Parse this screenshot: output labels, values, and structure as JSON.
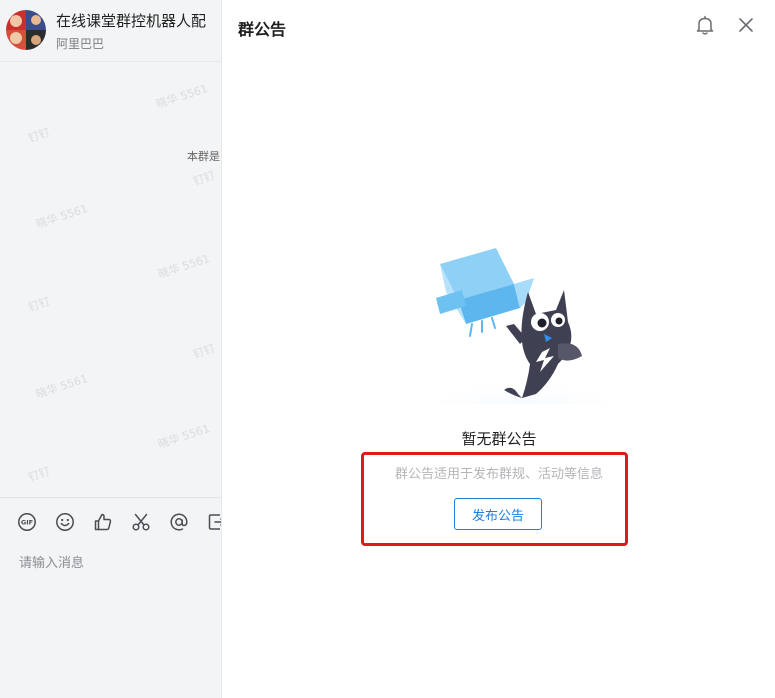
{
  "chat": {
    "title": "在线课堂群控机器人配",
    "subtitle": "阿里巴巴",
    "system_message": "本群是",
    "input_placeholder": "请输入消息",
    "watermarks": [
      "晓华 5561",
      "钉钉",
      "晓华 5561",
      "晓华 5561",
      "钉钉",
      "钉钉",
      "晓华 5561",
      "晓华 5561",
      "钉钉",
      "钉钉"
    ],
    "toolbar": {
      "gif_label": "GIF",
      "icons": [
        "gif-icon",
        "emoji-icon",
        "thumbs-up-icon",
        "scissors-icon",
        "at-icon",
        "forward-icon"
      ]
    }
  },
  "panel": {
    "title": "群公告",
    "empty_title": "暂无群公告",
    "empty_desc": "群公告适用于发布群规、活动等信息",
    "publish_label": "发布公告",
    "accent_color": "#1f7fe0",
    "highlight_color": "#e0191b"
  }
}
